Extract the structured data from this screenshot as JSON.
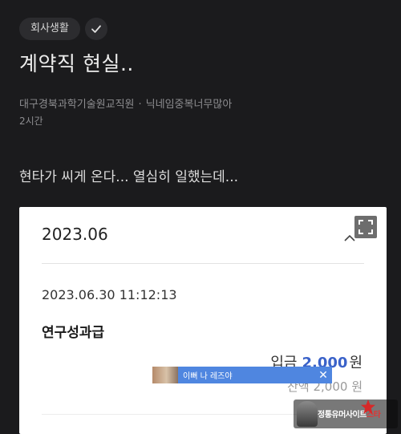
{
  "post": {
    "category": "회사생활",
    "title": "계약직 현실..",
    "author_company": "대구경북과학기술원교직원",
    "author_separator": "·",
    "author_nickname": "닉네임중복너무많아",
    "time_ago": "2시간",
    "body": "현타가 씨게 온다... 열심히 일했는데..."
  },
  "card": {
    "month": "2023.06",
    "transaction": {
      "datetime": "2023.06.30 11:12:13",
      "name": "연구성과급",
      "type_label": "입금",
      "amount": "2,000",
      "currency": "원",
      "balance_label": "잔액 2,000 원"
    }
  },
  "ad": {
    "text": "이뻐 나 레즈야",
    "close": "✕"
  },
  "watermark": {
    "text_white": "정통유머사이트",
    "text_red": "스타"
  },
  "colors": {
    "background": "#1b1b1d",
    "accent_amount": "#3a62c9",
    "ad_bar": "#4f86e0"
  },
  "icons": {
    "check": "check-icon",
    "chevron": "chevron-up-icon",
    "expand": "expand-icon",
    "close": "close-icon"
  }
}
